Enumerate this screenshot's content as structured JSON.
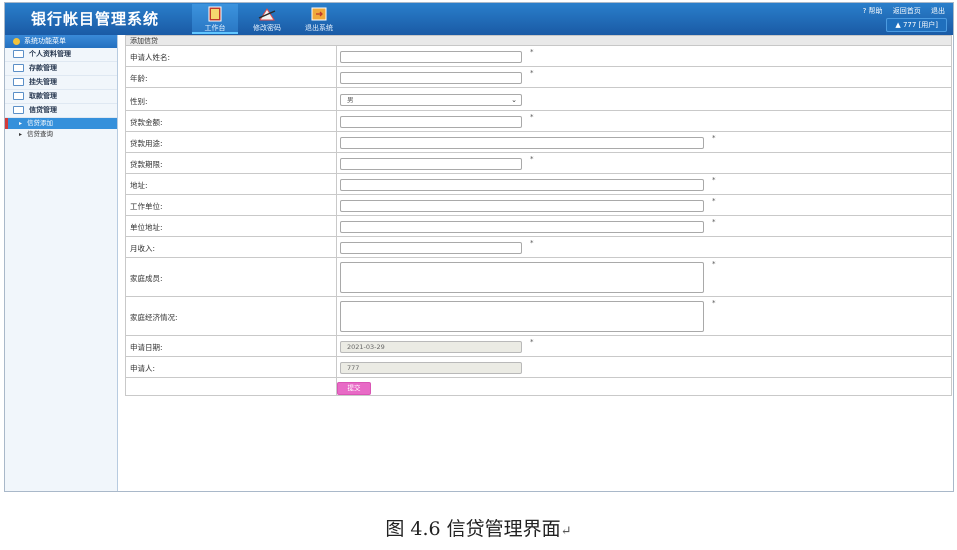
{
  "header": {
    "title": "银行帐目管理系统",
    "nav": [
      {
        "label": "工作台",
        "icon": "book-icon"
      },
      {
        "label": "修改密码",
        "icon": "edit-password-icon"
      },
      {
        "label": "退出系统",
        "icon": "exit-icon"
      }
    ],
    "links": {
      "help": "? 帮助",
      "home": "返回首页",
      "logout": "退出"
    },
    "user": "▲ 777 [用户]"
  },
  "sidebar": {
    "title": "系统功能菜单",
    "items": [
      "个人资料管理",
      "存款管理",
      "挂失管理",
      "取款管理",
      "信贷管理"
    ],
    "sub_items": [
      "信贷添加",
      "信贷查询"
    ]
  },
  "form": {
    "panel_title": "添加信贷",
    "fields": {
      "name": "申请人姓名:",
      "age": "年龄:",
      "gender": "性别:",
      "gender_value": "男",
      "amount": "贷款金额:",
      "purpose": "贷款用途:",
      "term": "贷款期限:",
      "address": "地址:",
      "employer": "工作单位:",
      "employer_address": "单位地址:",
      "income": "月收入:",
      "family": "家庭成员:",
      "finance": "家庭经济情况:",
      "date": "申请日期:",
      "date_value": "2021-03-29",
      "applicant": "申请人:",
      "applicant_value": "777"
    },
    "required_mark": "*",
    "submit": "提交"
  },
  "caption": "图 4.6 信贷管理界面",
  "caption_mark": "↵",
  "colors": {
    "header": "#1a5aa5",
    "active_menu": "#3590db",
    "submit": "#e86ac6"
  }
}
